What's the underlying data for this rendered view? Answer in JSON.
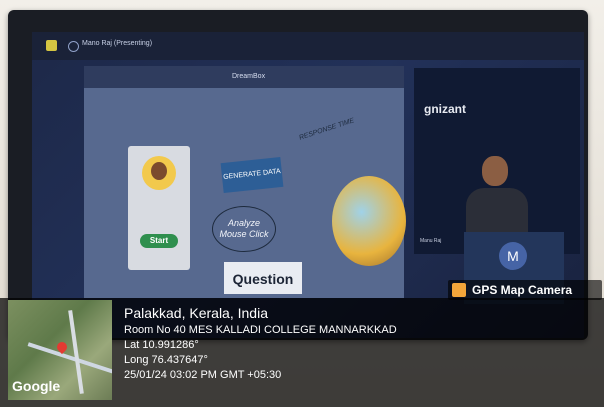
{
  "meeting": {
    "title": "Mano Raj (Presenting)",
    "shared_screen_title": "DreamBox",
    "card_button": "Start",
    "node_generate_data": "GENERATE DATA",
    "node_analyze_line1": "Analyze",
    "node_analyze_line2": "Mouse Click",
    "node_question": "Question",
    "response_time": "RESPONSE TIME",
    "brand_partial": "gnizant",
    "speaker_label": "Manu Raj",
    "participant_initial": "M"
  },
  "gps_overlay": {
    "badge_label": "GPS Map Camera",
    "place": "Palakkad, Kerala, India",
    "address": "Room No 40 MES KALLADI COLLEGE MANNARKKAD",
    "latitude": "Lat 10.991286°",
    "longitude": "Long 76.437647°",
    "timestamp": "25/01/24 03:02 PM GMT +05:30",
    "map_brand": "Google"
  },
  "colors": {
    "gps_pin": "#e33a32",
    "start_button": "#2f8f4e",
    "accent": "#2d5e96"
  }
}
